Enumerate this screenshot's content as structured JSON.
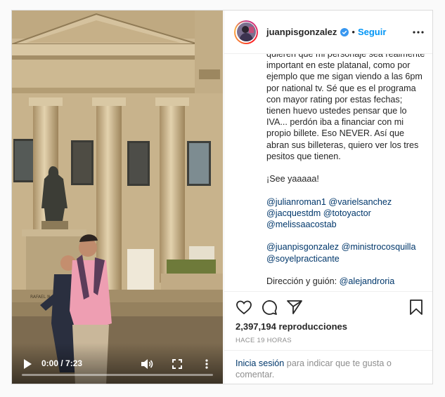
{
  "video": {
    "time_readout": "0:00 / 7:23",
    "progress": 0.0,
    "statue_plaque": "RAFAEL N."
  },
  "header": {
    "username": "juanpisgonzalez",
    "separator": "•",
    "follow_label": "Seguir"
  },
  "caption": {
    "paragraphs": [
      [
        {
          "t": "text",
          "v": "quieren que mi personaje sea realmente important en este platanal, como por ejemplo que me sigan viendo a las 6pm por national tv. Sé que es el programa con mayor rating por estas fechas; tienen huevo ustedes pensar que lo IVA... perdón iba a financiar con mi propio billete. Eso NEVER. Así que abran sus billeteras, quiero ver los tres pesitos que tienen."
        }
      ],
      [
        {
          "t": "text",
          "v": "¡See yaaaaa!"
        }
      ],
      [
        {
          "t": "mention",
          "v": "@julianroman1"
        },
        {
          "t": "text",
          "v": " "
        },
        {
          "t": "mention",
          "v": "@varielsanchez"
        },
        {
          "t": "text",
          "v": " "
        },
        {
          "t": "mention",
          "v": "@jacquestdm"
        },
        {
          "t": "text",
          "v": " "
        },
        {
          "t": "mention",
          "v": "@totoyactor"
        },
        {
          "t": "text",
          "v": " "
        },
        {
          "t": "mention",
          "v": "@melissaacostab"
        }
      ],
      [
        {
          "t": "mention",
          "v": "@juanpisgonzalez"
        },
        {
          "t": "text",
          "v": " "
        },
        {
          "t": "mention",
          "v": "@ministrocosquilla"
        },
        {
          "t": "text",
          "v": " "
        },
        {
          "t": "mention",
          "v": "@soyelpracticante"
        }
      ],
      [
        {
          "t": "text",
          "v": "Dirección y guión: "
        },
        {
          "t": "mention",
          "v": "@alejandroria"
        }
      ]
    ]
  },
  "stats": {
    "views": "2,397,194 reproducciones",
    "time_ago": "HACE 19 HORAS"
  },
  "login": {
    "link_label": "Inicia sesión",
    "rest": " para indicar que te gusta o comentar."
  },
  "icons": {
    "verified": "verified-badge-icon",
    "like": "heart-icon",
    "comment": "comment-icon",
    "share": "paper-plane-icon",
    "save": "bookmark-icon"
  },
  "colors": {
    "link_blue": "#0095f6",
    "mention": "#00376b",
    "muted": "#8e8e8e"
  }
}
